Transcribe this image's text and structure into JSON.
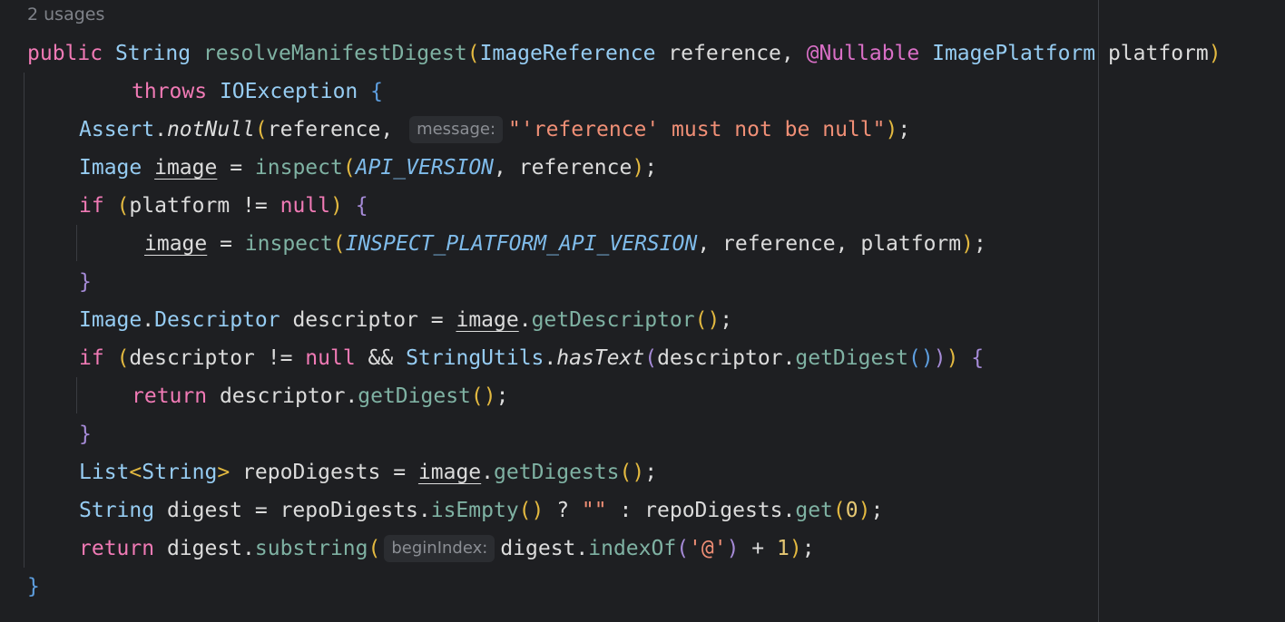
{
  "editor": {
    "usages_hint": "2 usages",
    "code": {
      "l1": {
        "kw_public": "public",
        "type_string": "String",
        "method_name": "resolveManifestDigest",
        "paren_open": "(",
        "type_image_reference": "ImageReference",
        "param_reference": " reference, ",
        "annotation_nullable": "@Nullable",
        "type_image_platform": "ImagePlatform",
        "param_platform": " platform",
        "paren_close": ")"
      },
      "l2": {
        "kw_throws": "throws",
        "type_ioexception": "IOException",
        "brace_open": "{"
      },
      "l3": {
        "class_assert": "Assert",
        "dot": ".",
        "method_notnull": "notNull",
        "paren_open": "(",
        "arg_reference": "reference, ",
        "inlay_message": "message:",
        "string_message": "\"'reference' must not be null\"",
        "paren_close": ")",
        "semicolon": ";"
      },
      "l4": {
        "type_image": "Image",
        "var_image": "image",
        "equals": " = ",
        "method_inspect": "inspect",
        "paren_open": "(",
        "const_api_version": "API_VERSION",
        "args_rest": ", reference",
        "paren_close": ")",
        "semicolon": ";"
      },
      "l5": {
        "kw_if": "if",
        "paren_open": "(",
        "cond_text": "platform != ",
        "kw_null": "null",
        "paren_close": ")",
        "brace_open": "{"
      },
      "l6": {
        "var_image": "image",
        "equals": " = ",
        "method_inspect": "inspect",
        "paren_open": "(",
        "const_inspect_platform": "INSPECT_PLATFORM_API_VERSION",
        "args_rest": ", reference, platform",
        "paren_close": ")",
        "semicolon": ";"
      },
      "l7": {
        "brace_close": "}"
      },
      "l8": {
        "type_image": "Image",
        "dot": ".",
        "type_descriptor": "Descriptor",
        "var_descriptor": " descriptor = ",
        "var_image": "image",
        "dot2": ".",
        "method_getdescriptor": "getDescriptor",
        "parens": "()",
        "semicolon": ";"
      },
      "l9": {
        "kw_if": "if",
        "paren_open": "(",
        "cond_text": "descriptor != ",
        "kw_null": "null",
        "and_op": " && ",
        "class_stringutils": "StringUtils",
        "dot": ".",
        "method_hastext": "hasText",
        "paren_open2": "(",
        "arg_descriptor": "descriptor.",
        "method_getdigest": "getDigest",
        "parens_inner": "()",
        "paren_close2": ")",
        "paren_close": ")",
        "brace_open": "{"
      },
      "l10": {
        "kw_return": "return",
        "expr_descriptor": " descriptor.",
        "method_getdigest": "getDigest",
        "parens": "()",
        "semicolon": ";"
      },
      "l11": {
        "brace_close": "}"
      },
      "l12": {
        "type_list": "List",
        "angle_open": "<",
        "type_string": "String",
        "angle_close": ">",
        "var_repodigests": " repoDigests = ",
        "var_image": "image",
        "dot": ".",
        "method_getdigests": "getDigests",
        "parens": "()",
        "semicolon": ";"
      },
      "l13": {
        "type_string": "String",
        "var_digest": " digest = repoDigests.",
        "method_isempty": "isEmpty",
        "parens": "()",
        "ternary_q": " ? ",
        "string_empty": "\"\"",
        "ternary_colon": " : repoDigests.",
        "method_get": "get",
        "paren_open": "(",
        "num_zero": "0",
        "paren_close": ")",
        "semicolon": ";"
      },
      "l14": {
        "kw_return": "return",
        "expr_digest": " digest.",
        "method_substring": "substring",
        "paren_open": "(",
        "inlay_beginindex": "beginIndex:",
        "expr_digest2": "digest.",
        "method_indexof": "indexOf",
        "paren_open2": "(",
        "char_at": "'@'",
        "paren_close2": ")",
        "plus": " + ",
        "num_one": "1",
        "paren_close": ")",
        "semicolon": ";"
      },
      "l15": {
        "brace_close": "}"
      }
    },
    "colors": {
      "background": "#1e1f22",
      "keyword": "#f07ab5",
      "type": "#96ccf2",
      "method": "#7fb2a3",
      "string": "#f08f76",
      "constant": "#7fbbea",
      "annotation": "#d96fc6",
      "number": "#e6c874",
      "paren_level1": "#e3b940",
      "paren_level2": "#a68bd8",
      "brace": "#5e9fe0"
    }
  }
}
